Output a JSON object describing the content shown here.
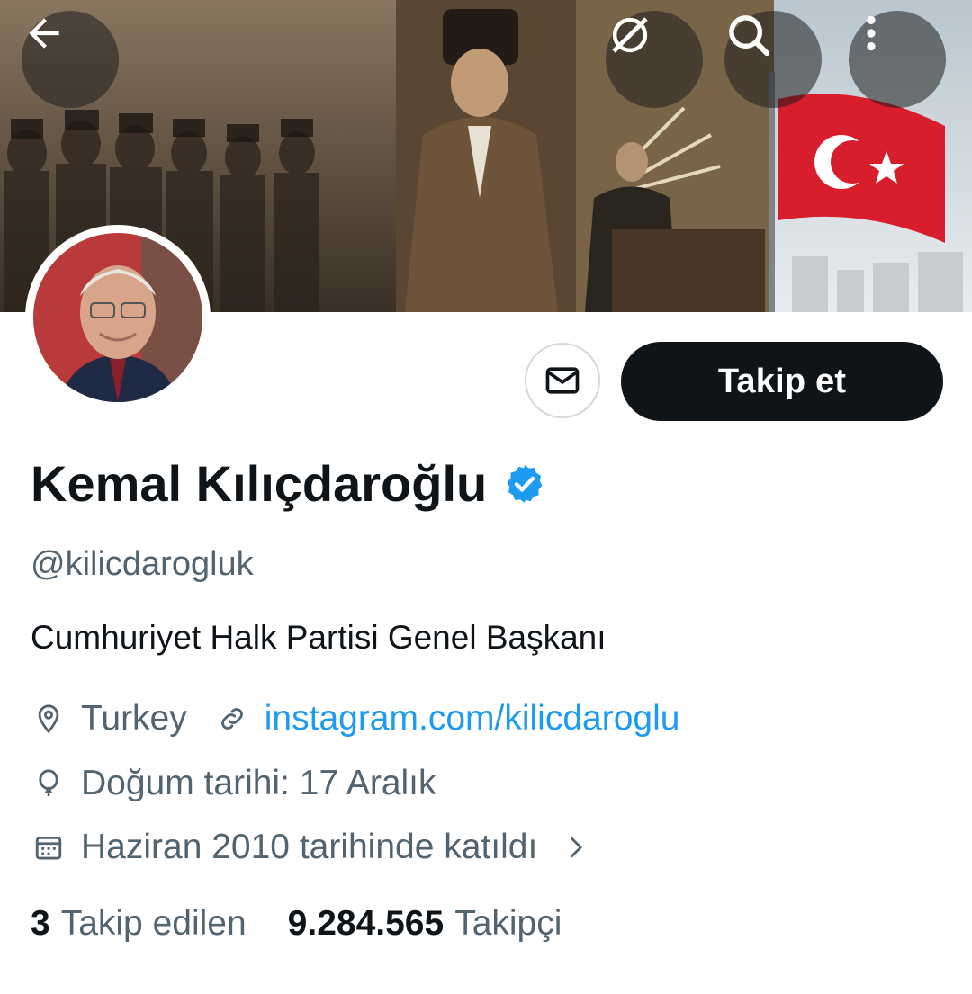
{
  "header": {
    "back_icon": "arrow-left-icon",
    "translate_icon": "grok-slash-icon",
    "search_icon": "search-icon",
    "more_icon": "more-vertical-icon"
  },
  "profile": {
    "name": "Kemal Kılıçdaroğlu",
    "verified": true,
    "verified_color": "#1d9bf0",
    "handle": "@kilicdarogluk",
    "bio": "Cumhuriyet Halk Partisi Genel Başkanı",
    "location": "Turkey",
    "website": "instagram.com/kilicdaroglu",
    "birthday": "Doğum tarihi: 17 Aralık",
    "joined": "Haziran 2010 tarihinde katıldı"
  },
  "actions": {
    "follow_label": "Takip et",
    "message_icon": "envelope-icon"
  },
  "stats": {
    "following_count": "3",
    "following_label": "Takip edilen",
    "followers_count": "9.284.565",
    "followers_label": "Takipçi"
  },
  "colors": {
    "primary_text": "#0f1419",
    "secondary_text": "#536471",
    "link": "#1d9bf0"
  }
}
